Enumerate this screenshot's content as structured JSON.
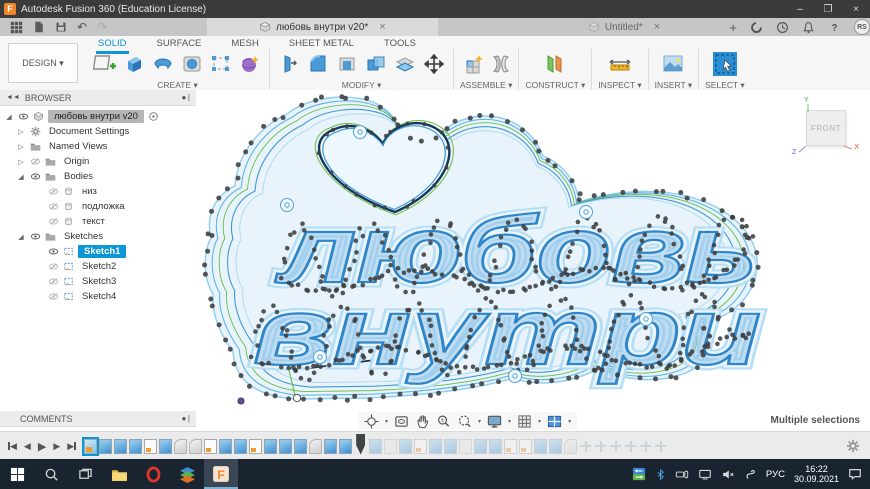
{
  "window": {
    "title": "Autodesk Fusion 360 (Education License)",
    "minimize": "–",
    "maximize": "❐",
    "close": "×"
  },
  "tabbar": {
    "active_tab": "любовь внутри v20*",
    "inactive_tab": "Untitled*",
    "new_tab": "+",
    "avatar": "RS",
    "close": "×"
  },
  "ribbon": {
    "design_label": "DESIGN ▾",
    "tabs": [
      "SOLID",
      "SURFACE",
      "MESH",
      "SHEET METAL",
      "TOOLS"
    ],
    "active_tab": "SOLID",
    "sections": [
      "CREATE ▾",
      "MODIFY ▾",
      "ASSEMBLE ▾",
      "CONSTRUCT ▾",
      "INSPECT ▾",
      "INSERT ▾",
      "SELECT ▾"
    ]
  },
  "browser": {
    "header": "BROWSER",
    "root_label": "любовь внутри v20",
    "items": [
      {
        "label": "Document Settings",
        "icon": "gear",
        "arrow": "collapsed",
        "eye": "none",
        "level": 1,
        "selected": false
      },
      {
        "label": "Named Views",
        "icon": "folder",
        "arrow": "collapsed",
        "eye": "none",
        "level": 1,
        "selected": false
      },
      {
        "label": "Origin",
        "icon": "folder",
        "arrow": "collapsed",
        "eye": "off",
        "level": 1,
        "selected": false
      },
      {
        "label": "Bodies",
        "icon": "folder",
        "arrow": "expanded",
        "eye": "on",
        "level": 1,
        "selected": false
      },
      {
        "label": "низ",
        "icon": "body",
        "arrow": "none",
        "eye": "off",
        "level": 2,
        "selected": false
      },
      {
        "label": "подложка",
        "icon": "body",
        "arrow": "none",
        "eye": "off",
        "level": 2,
        "selected": false
      },
      {
        "label": "текст",
        "icon": "body",
        "arrow": "none",
        "eye": "off",
        "level": 2,
        "selected": false
      },
      {
        "label": "Sketches",
        "icon": "folder",
        "arrow": "expanded",
        "eye": "on",
        "level": 1,
        "selected": false
      },
      {
        "label": "Sketch1",
        "icon": "sketch",
        "arrow": "none",
        "eye": "on",
        "level": 2,
        "selected": true
      },
      {
        "label": "Sketch2",
        "icon": "sketch",
        "arrow": "none",
        "eye": "off",
        "level": 2,
        "selected": false
      },
      {
        "label": "Sketch3",
        "icon": "sketch",
        "arrow": "none",
        "eye": "off",
        "level": 2,
        "selected": false
      },
      {
        "label": "Sketch4",
        "icon": "sketch",
        "arrow": "none",
        "eye": "off",
        "level": 2,
        "selected": false
      }
    ]
  },
  "comments": {
    "header": "COMMENTS"
  },
  "canvas": {
    "word1": "любовь",
    "word2": "внутри"
  },
  "viewcube": {
    "front": "FRONT",
    "x": "X",
    "y": "Y",
    "z": "Z"
  },
  "status": {
    "selection": "Multiple selections"
  },
  "timeline": {
    "features": [
      "sketch-sel",
      "extrude",
      "extrude",
      "extrude",
      "sketch",
      "extrude",
      "fillet",
      "fillet",
      "sketch",
      "extrude",
      "extrude",
      "sketch",
      "extrude",
      "extrude",
      "extrude",
      "fillet",
      "extrude",
      "extrude",
      "marker",
      "extrude-f",
      "box-f",
      "extrude-f",
      "sketch-f",
      "extrude-f",
      "extrude-f",
      "box-f",
      "extrude-f",
      "extrude-f",
      "sketch-f",
      "sketch-f",
      "extrude-f",
      "extrude-f",
      "fillet-f",
      "move-f",
      "move-f",
      "move-f",
      "move-f",
      "move-f",
      "move-f"
    ]
  },
  "taskbar": {
    "language": "РУС",
    "time": "16:22",
    "date": "30.09.2021"
  },
  "colors": {
    "accent": "#0a96d7",
    "sketch_blue": "#2e86c8",
    "offset_green": "#6cbf4a",
    "fusion_orange": "#f0862b"
  }
}
